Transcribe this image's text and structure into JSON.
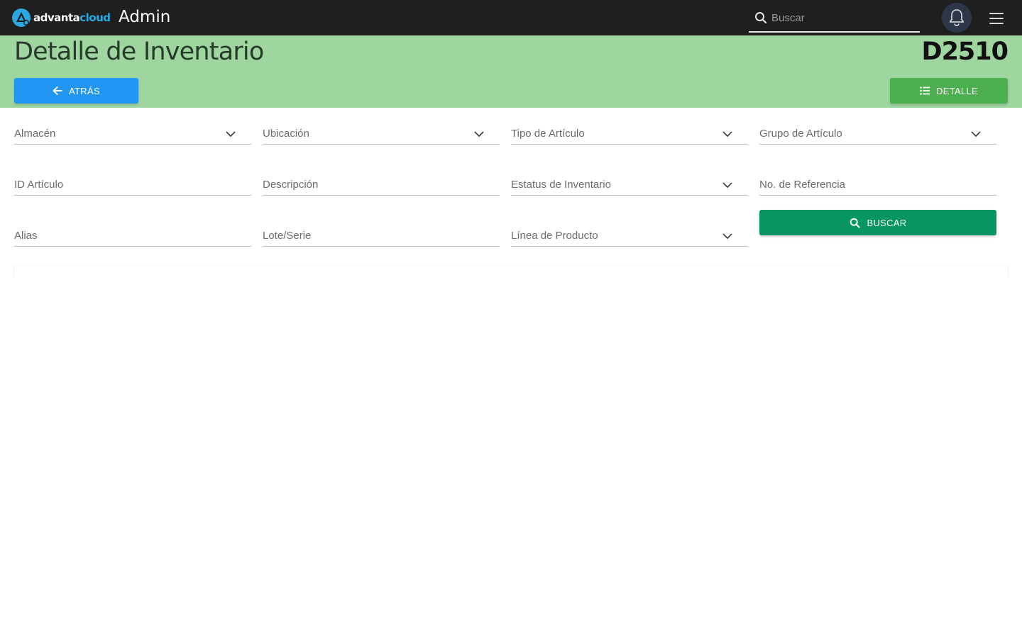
{
  "app": {
    "brand_part1": "advanta",
    "brand_part2": "cloud",
    "title": "Admin"
  },
  "topbar": {
    "search_placeholder": "Buscar",
    "search_value": ""
  },
  "header": {
    "title": "Detalle de Inventario",
    "code": "D2510",
    "back_label": "ATRÁS",
    "detail_label": "DETALLE",
    "background": "#9fd6a0"
  },
  "filters": {
    "almacen": "Almacén",
    "ubicacion": "Ubicación",
    "tipo_articulo": "Tipo de Artículo",
    "grupo_articulo": "Grupo de Artículo",
    "id_articulo": "ID Artículo",
    "descripcion": "Descripción",
    "estatus_inventario": "Estatus de Inventario",
    "no_referencia": "No. de Referencia",
    "alias": "Alias",
    "lote_serie": "Lote/Serie",
    "linea_producto": "Línea de Producto",
    "search_label": "BUSCAR"
  },
  "colors": {
    "topbar": "#1f1f1f",
    "back_button": "#2196f3",
    "detail_button": "#4caf50",
    "search_button": "#079562",
    "brand_accent": "#2aa9e0"
  },
  "icons": {
    "logo": "advantacloud-logo-icon",
    "search": "search-icon",
    "bell": "bell-icon",
    "menu": "hamburger-menu-icon",
    "back": "arrow-left-icon",
    "detail": "list-icon",
    "dropdown": "chevron-down-icon"
  }
}
